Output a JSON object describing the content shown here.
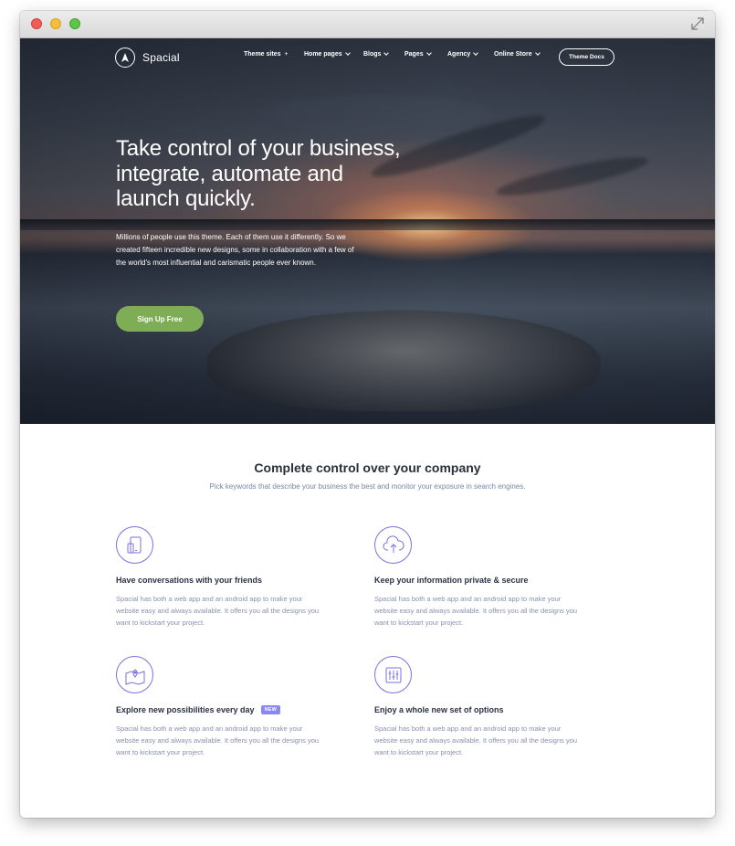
{
  "window": {
    "title": ""
  },
  "brand": {
    "name": "Spacial"
  },
  "nav": {
    "items": [
      {
        "label": "Theme sites",
        "suffix": "+"
      },
      {
        "label": "Home pages"
      },
      {
        "label": "Blogs"
      },
      {
        "label": "Pages"
      },
      {
        "label": "Agency"
      },
      {
        "label": "Online Store"
      }
    ],
    "docs_button": "Theme Docs"
  },
  "hero": {
    "title": "Take control of your business, integrate, automate and launch quickly.",
    "text": "Millions of people use this theme. Each of them use it differently. So we created fifteen incredible new designs, some in collaboration with a few of the world's most influential and carismatic people ever known.",
    "cta": "Sign Up Free"
  },
  "section": {
    "title": "Complete control over your company",
    "subtitle": "Pick keywords that describe your business the best and monitor your exposure in search engines."
  },
  "features": [
    {
      "icon": "devices-icon",
      "title": "Have conversations with your friends",
      "badge": "",
      "text": "Spacial has both a web app and an android app to make your website easy and always available. It offers you all the designs you want to kickstart your project."
    },
    {
      "icon": "cloud-upload-icon",
      "title": "Keep your information private & secure",
      "badge": "",
      "text": "Spacial has both a web app and an android app to make your website easy and always available. It offers you all the designs you want to kickstart your project."
    },
    {
      "icon": "map-pin-icon",
      "title": "Explore new possibilities every day",
      "badge": "NEW",
      "text": "Spacial has both a web app and an android app to make your website easy and always available. It offers you all the designs you want to kickstart your project."
    },
    {
      "icon": "sliders-icon",
      "title": "Enjoy a whole new set of options",
      "badge": "",
      "text": "Spacial has both a web app and an android app to make your website easy and always available. It offers you all the designs you want to kickstart your project."
    }
  ],
  "colors": {
    "accent": "#7a72df",
    "cta": "#7fad55",
    "badge": "#8a88f0",
    "heading": "#2b3246",
    "muted": "#8890ad"
  }
}
